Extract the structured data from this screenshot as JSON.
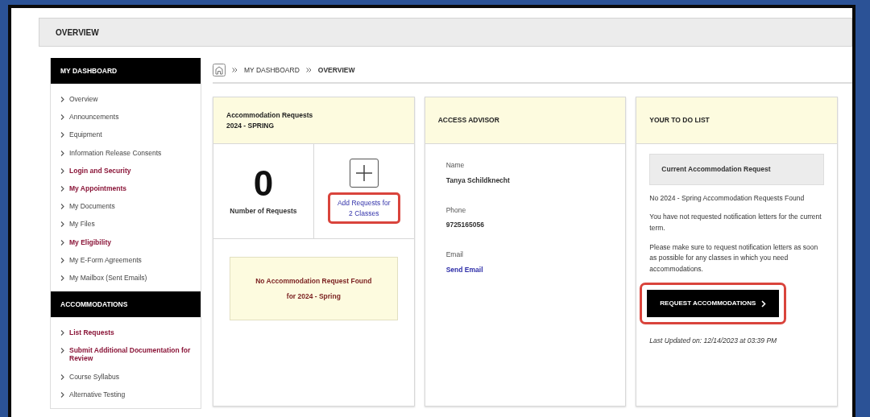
{
  "page_title": "OVERVIEW",
  "sidebar": [
    {
      "heading": "MY DASHBOARD",
      "items": [
        {
          "label": "Overview",
          "highlighted": false
        },
        {
          "label": "Announcements",
          "highlighted": false
        },
        {
          "label": "Equipment",
          "highlighted": false
        },
        {
          "label": "Information Release Consents",
          "highlighted": false
        },
        {
          "label": "Login and Security",
          "highlighted": true
        },
        {
          "label": "My Appointments",
          "highlighted": true
        },
        {
          "label": "My Documents",
          "highlighted": false
        },
        {
          "label": "My Files",
          "highlighted": false
        },
        {
          "label": "My Eligibility",
          "highlighted": true
        },
        {
          "label": "My E-Form Agreements",
          "highlighted": false
        },
        {
          "label": "My Mailbox (Sent Emails)",
          "highlighted": false
        }
      ]
    },
    {
      "heading": "ACCOMMODATIONS",
      "items": [
        {
          "label": "List Requests",
          "highlighted": true
        },
        {
          "label": "Submit Additional Documentation for Review",
          "highlighted": true
        },
        {
          "label": "Course Syllabus",
          "highlighted": false
        },
        {
          "label": "Alternative Testing",
          "highlighted": false
        }
      ]
    }
  ],
  "breadcrumb": [
    {
      "label": "MY DASHBOARD",
      "current": false
    },
    {
      "label": "OVERVIEW",
      "current": true
    }
  ],
  "requests_card": {
    "title_line_1": "Accommodation Requests",
    "title_line_2": "2024 - SPRING",
    "count": "0",
    "count_label": "Number of Requests",
    "add_link": "Add Requests for 2 Classes",
    "add_link_annotated": true,
    "notice": "No Accommodation Request Found for 2024 - Spring"
  },
  "advisor_card": {
    "title": "ACCESS ADVISOR",
    "fields": [
      {
        "label": "Name",
        "value": "Tanya Schildknecht",
        "kind": "text"
      },
      {
        "label": "Phone",
        "value": "9725165056",
        "kind": "text"
      },
      {
        "label": "Email",
        "value": "Send Email",
        "kind": "link"
      }
    ]
  },
  "todo_card": {
    "title": "YOUR TO DO LIST",
    "subheading": "Current Accommodation Request",
    "paragraphs": [
      "No 2024 - Spring Accommodation Requests Found",
      "You have not requested notification letters for the current term.",
      "Please make sure to request notification letters as soon as possible for any classes in which you need accommodations."
    ],
    "button": "REQUEST ACCOMMODATIONS",
    "button_annotated": true,
    "updated_prefix": "Last Updated on:",
    "updated_value": "12/14/2023 at 03:39 PM"
  }
}
